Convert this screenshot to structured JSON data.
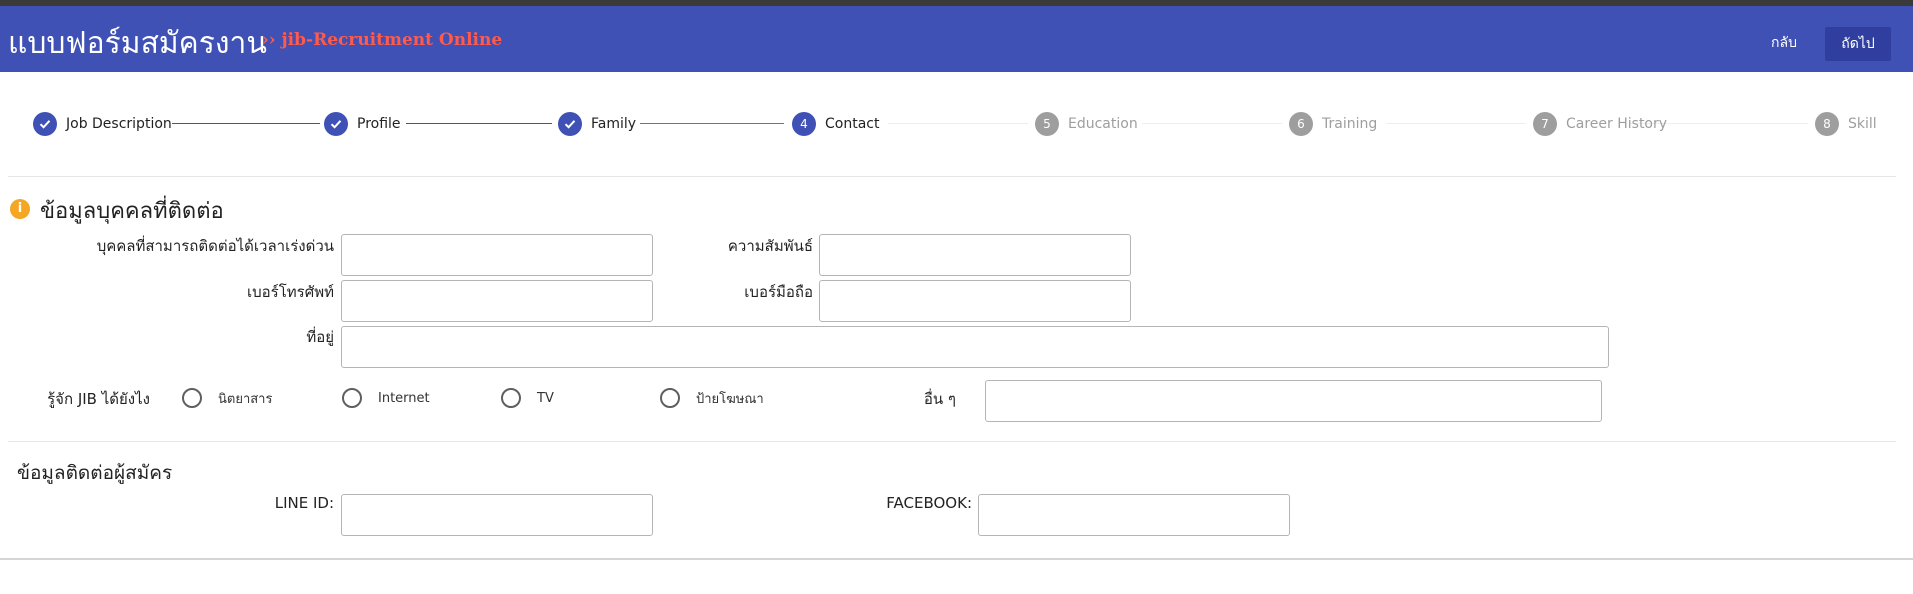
{
  "header": {
    "title": "แบบฟอร์มสมัครงาน",
    "subtitle": "›› jib-Recruitment Online",
    "back_label": "กลับ",
    "next_label": "ถัดไป",
    "colors": {
      "bar": "#3f51b5",
      "accent": "#ff5a4a",
      "next_button": "#303f9f"
    }
  },
  "stepper": {
    "steps": [
      {
        "label": "Job Description",
        "status": "done",
        "icon": "check-icon"
      },
      {
        "label": "Profile",
        "status": "done",
        "icon": "check-icon"
      },
      {
        "label": "Family",
        "status": "done",
        "icon": "check-icon"
      },
      {
        "number": "4",
        "label": "Contact",
        "status": "active"
      },
      {
        "number": "5",
        "label": "Education",
        "status": "pending"
      },
      {
        "number": "6",
        "label": "Training",
        "status": "pending"
      },
      {
        "number": "7",
        "label": "Career History",
        "status": "pending"
      },
      {
        "number": "8",
        "label": "Skill",
        "status": "pending"
      }
    ]
  },
  "emergency": {
    "title": "ข้อมูลบุคคลที่ติดต่อ",
    "icon": "info-icon",
    "fields": {
      "contact_person_label": "บุคคลที่สามารถติดต่อได้เวลาเร่งด่วน",
      "contact_person_value": "",
      "relationship_label": "ความสัมพันธ์",
      "relationship_value": "",
      "phone_label": "เบอร์โทรศัพท์",
      "phone_value": "",
      "mobile_label": "เบอร์มือถือ",
      "mobile_value": "",
      "address_label": "ที่อยู่",
      "address_value": ""
    },
    "source": {
      "label": "รู้จัก JIB ได้ยังไง",
      "options": [
        "นิตยาสาร",
        "Internet",
        "TV",
        "ป้ายโฆษณา"
      ],
      "selected": null,
      "other_label": "อื่น ๆ",
      "other_value": ""
    }
  },
  "applicant": {
    "title": "ข้อมูลติดต่อผู้สมัคร",
    "line_label": "LINE ID:",
    "line_value": "",
    "facebook_label": "FACEBOOK:",
    "facebook_value": ""
  }
}
